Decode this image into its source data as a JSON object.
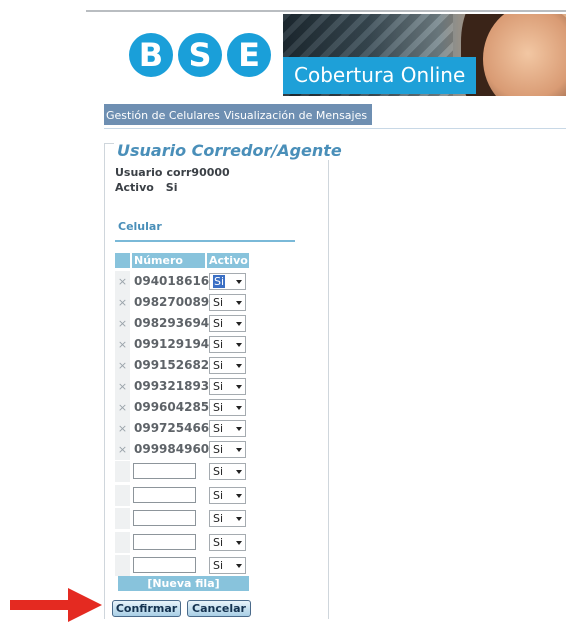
{
  "brand": {
    "logo_letters": [
      "B",
      "S",
      "E"
    ],
    "banner_title": "Cobertura Online",
    "accent_color": "#1ea0d8"
  },
  "nav": {
    "items": [
      "Gestión de Celulares",
      "Visualización de Mensajes"
    ]
  },
  "panel": {
    "legend": "Usuario Corredor/Agente",
    "usuario_label": "Usuario",
    "usuario_value": "corr90000",
    "activo_label": "Activo",
    "activo_value": "Si",
    "section_title": "Celular"
  },
  "table": {
    "headers": [
      "Número",
      "Activo"
    ],
    "remove_glyph": "×",
    "rows": [
      {
        "numero": "094018616",
        "activo": "Si"
      },
      {
        "numero": "098270089",
        "activo": "Si"
      },
      {
        "numero": "098293694",
        "activo": "Si"
      },
      {
        "numero": "099129194",
        "activo": "Si"
      },
      {
        "numero": "099152682",
        "activo": "Si"
      },
      {
        "numero": "099321893",
        "activo": "Si"
      },
      {
        "numero": "099604285",
        "activo": "Si"
      },
      {
        "numero": "099725466",
        "activo": "Si"
      },
      {
        "numero": "099984960",
        "activo": "Si"
      }
    ],
    "empty_rows": [
      {
        "numero": "",
        "activo": "Si"
      },
      {
        "numero": "",
        "activo": "Si"
      },
      {
        "numero": "",
        "activo": "Si"
      },
      {
        "numero": "",
        "activo": "Si"
      },
      {
        "numero": "",
        "activo": "Si"
      }
    ],
    "new_row_label": "[Nueva fila]"
  },
  "actions": {
    "confirm_label": "Confirmar",
    "cancel_label": "Cancelar"
  }
}
